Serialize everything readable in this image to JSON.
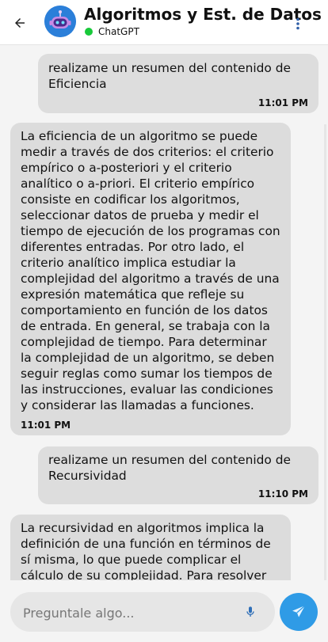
{
  "header": {
    "title": "Algoritmos y Est. de Datos",
    "status": "ChatGPT",
    "status_color": "#18c93a",
    "back_icon": "arrow-back-icon",
    "menu_icon": "more-vert-icon",
    "avatar_icon": "robot-avatar-icon"
  },
  "messages": [
    {
      "role": "user",
      "text": "realizame un resumen del contenido de Eficiencia",
      "time": "11:01 PM"
    },
    {
      "role": "assistant",
      "text": "La eficiencia de un algoritmo se puede medir a través de dos criterios: el criterio empírico o a-posteriori y el criterio analítico o a-priori. El criterio empírico consiste en codificar los algoritmos, seleccionar datos de prueba y medir el tiempo de ejecución de los programas con diferentes entradas. Por otro lado, el criterio analítico implica estudiar la complejidad del algoritmo a través de una expresión matemática que refleje su comportamiento en función de los datos de entrada. En general, se trabaja con la complejidad de tiempo. Para determinar la complejidad de un algoritmo, se deben seguir reglas como sumar los tiempos de las instrucciones, evaluar las condiciones y considerar las llamadas a funciones.",
      "time": "11:01 PM"
    },
    {
      "role": "user",
      "text": "realizame un resumen del contenido de Recursividad",
      "time": "11:10 PM"
    },
    {
      "role": "assistant",
      "text": "La recursividad en algoritmos implica la definición de una función en términos de sí misma, lo que puede complicar el cálculo de su complejidad. Para resolver este tipo",
      "time": ""
    }
  ],
  "input": {
    "placeholder": "Preguntale algo...",
    "value": "",
    "mic_icon": "microphone-icon",
    "send_icon": "send-icon"
  },
  "colors": {
    "accent": "#2f9be6",
    "bubble": "#dddddd",
    "background": "#f4f4f4"
  }
}
